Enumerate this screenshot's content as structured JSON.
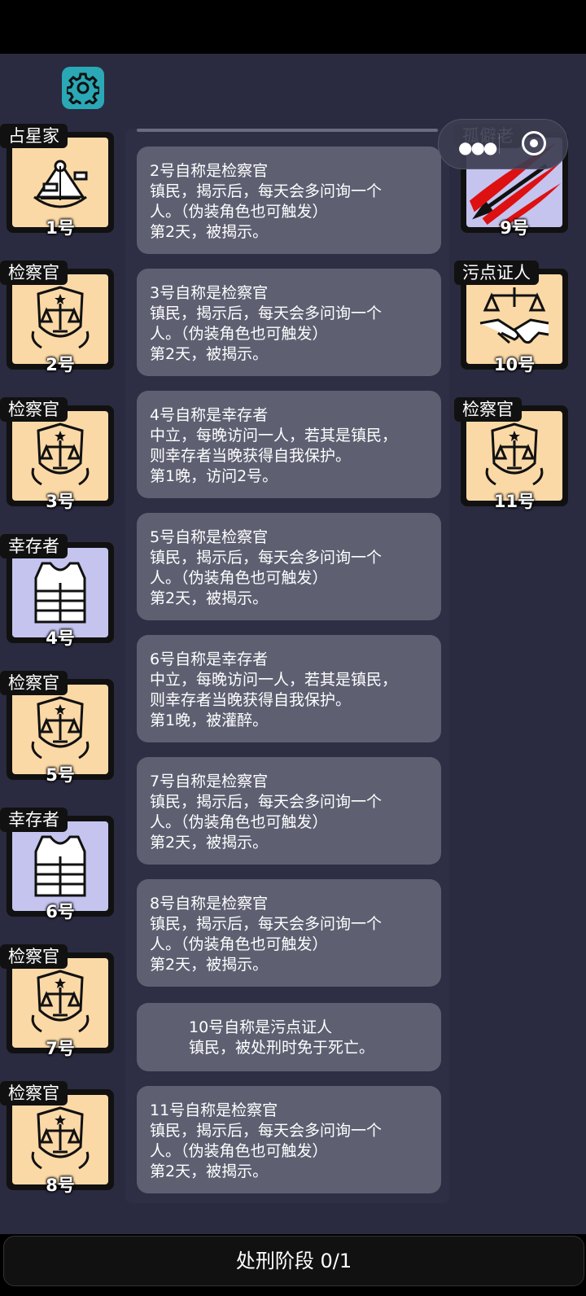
{
  "players_left": [
    {
      "role": "占星家",
      "num": "1号",
      "bg": "tan",
      "icon": "sextant-icon"
    },
    {
      "role": "检察官",
      "num": "2号",
      "bg": "tan",
      "icon": "scales-badge-icon"
    },
    {
      "role": "检察官",
      "num": "3号",
      "bg": "tan",
      "icon": "scales-badge-icon"
    },
    {
      "role": "幸存者",
      "num": "4号",
      "bg": "purple",
      "icon": "vest-icon"
    },
    {
      "role": "检察官",
      "num": "5号",
      "bg": "tan",
      "icon": "scales-badge-icon"
    },
    {
      "role": "幸存者",
      "num": "6号",
      "bg": "purple",
      "icon": "vest-icon"
    },
    {
      "role": "检察官",
      "num": "7号",
      "bg": "tan",
      "icon": "scales-badge-icon"
    },
    {
      "role": "检察官",
      "num": "8号",
      "bg": "tan",
      "icon": "scales-badge-icon"
    }
  ],
  "players_right": [
    {
      "role": "孤僻老",
      "num": "9号",
      "bg": "purple",
      "icon": "claw-gun-icon"
    },
    {
      "role": "污点证人",
      "num": "10号",
      "bg": "tan",
      "icon": "handshake-scales-icon"
    },
    {
      "role": "检察官",
      "num": "11号",
      "bg": "tan",
      "icon": "scales-badge-icon"
    }
  ],
  "messages": [
    {
      "lines": [
        "2号自称是检察官",
        "镇民，揭示后，每天会多问询一个",
        "人。（伪装角色也可触发）",
        "第2天，被揭示。"
      ]
    },
    {
      "lines": [
        "3号自称是检察官",
        "镇民，揭示后，每天会多问询一个",
        "人。（伪装角色也可触发）",
        "第2天，被揭示。"
      ]
    },
    {
      "lines": [
        "4号自称是幸存者",
        "中立，每晚访问一人，若其是镇民，",
        "则幸存者当晚获得自我保护。",
        "第1晚，访问2号。"
      ]
    },
    {
      "lines": [
        "5号自称是检察官",
        "镇民，揭示后，每天会多问询一个",
        "人。（伪装角色也可触发）",
        "第2天，被揭示。"
      ]
    },
    {
      "lines": [
        "6号自称是幸存者",
        "中立，每晚访问一人，若其是镇民，",
        "则幸存者当晚获得自我保护。",
        "第1晚，被灌醉。"
      ]
    },
    {
      "lines": [
        "7号自称是检察官",
        "镇民，揭示后，每天会多问询一个",
        "人。（伪装角色也可触发）",
        "第2天，被揭示。"
      ]
    },
    {
      "lines": [
        "8号自称是检察官",
        "镇民，揭示后，每天会多问询一个",
        "人。（伪装角色也可触发）",
        "第2天，被揭示。"
      ]
    },
    {
      "lines": [
        "10号自称是污点证人",
        "镇民，被处刑时免于死亡。"
      ]
    },
    {
      "lines": [
        "11号自称是检察官",
        "镇民，揭示后，每天会多问询一个",
        "人。（伪装角色也可触发）",
        "第2天，被揭示。"
      ]
    }
  ],
  "phase_button": "处刑阶段 0/1",
  "colors": {
    "tan": "#fbd9a6",
    "purple": "#c4c4ef",
    "accent": "#2aa8b6",
    "background": "#2a2b40",
    "message": "#5e6072"
  }
}
